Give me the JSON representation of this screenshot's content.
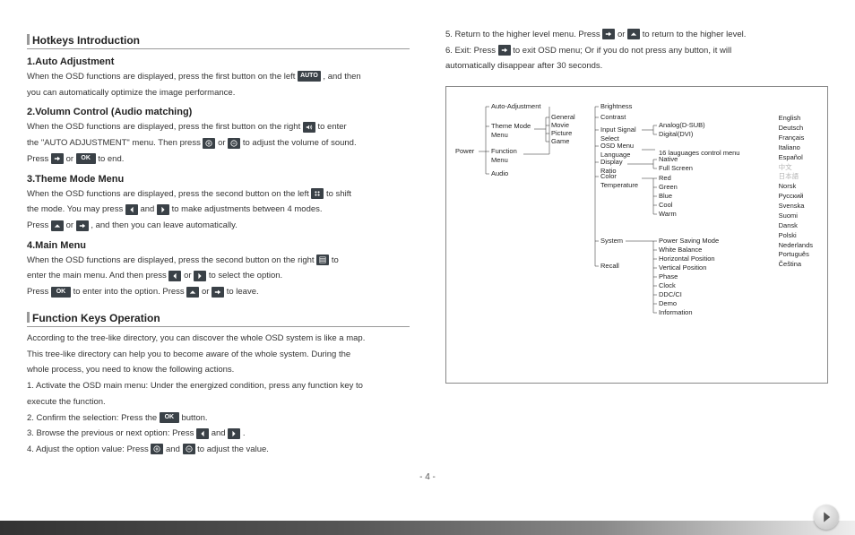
{
  "sections": {
    "hotkeys_title": "Hotkeys Introduction",
    "auto_adj": {
      "title": "1.Auto Adjustment",
      "l1a": "When the OSD functions are displayed, press the first button on the left ",
      "l1b": " , and then",
      "l2": "you can automatically optimize the image performance."
    },
    "volume": {
      "title": "2.Volumn Control (Audio matching)",
      "l1a": "When the OSD functions are displayed, press the first button on the right ",
      "l1b": " to enter",
      "l2a": "the \"AUTO ADJUSTMENT\" menu. Then press ",
      "l2b": " or ",
      "l2c": " to adjust the volume of sound.",
      "l3a": "Press ",
      "l3b": " or ",
      "l3c": " to end."
    },
    "theme": {
      "title": "3.Theme Mode Menu",
      "l1a": "When the OSD functions are displayed, press the second button on the left ",
      "l1b": " to shift",
      "l2a": "the mode. You may press ",
      "l2b": " and ",
      "l2c": " to make adjustments between 4 modes.",
      "l3a": "Press ",
      "l3b": " or ",
      "l3c": " , and then you can leave automatically."
    },
    "main": {
      "title": "4.Main Menu",
      "l1a": "When the OSD functions are displayed, press the second button on the right ",
      "l1b": " to",
      "l2a": "enter the main menu. And then press ",
      "l2b": " or ",
      "l2c": " to select the option.",
      "l3a": "Press ",
      "l3b": " to enter into the option. Press ",
      "l3c": " or ",
      "l3d": " to leave."
    },
    "fkeys_title": "Function Keys Operation",
    "fkeys": {
      "p1": "According to the tree-like directory, you can discover the whole OSD system is like a map.",
      "p2": "This tree-like directory can help you to become aware of the whole system. During the",
      "p3": "whole process, you need to know the following actions.",
      "p4": "1. Activate the OSD main menu: Under the energized condition, press any function key to",
      "p4b": "execute the function.",
      "p5a": "2. Confirm the selection: Press the ",
      "p5b": " button.",
      "p6a": "3. Browse the previous or next option: Press ",
      "p6b": " and ",
      "p6c": " .",
      "p7a": "4. Adjust the option value: Press ",
      "p7b": " and ",
      "p7c": " to adjust the value."
    },
    "right": {
      "p5a": "5. Return to the higher level menu. Press ",
      "p5b": " or ",
      "p5c": " to return to the higher level.",
      "p6a": "6. Exit: Press ",
      "p6b": " to exit OSD menu; Or if you do not press any button, it will",
      "p6c": "automatically disappear after 30 seconds."
    }
  },
  "buttons": {
    "auto": "AUTO",
    "ok": "OK",
    "exit": "EXIT"
  },
  "tree": {
    "power": "Power",
    "auto_adj": "Auto-Adjustment",
    "theme_menu": "Theme Mode\nMenu",
    "function_menu": "Function\nMenu",
    "audio": "Audio",
    "theme_items": [
      "General",
      "Movie",
      "Picture",
      "Game"
    ],
    "fn_items": [
      "Brightness",
      "Contrast",
      "Input Signal\nSelect",
      "OSD Menu\nLanguage",
      "Display\nRatio",
      "Color\nTemperature",
      "System",
      "Recall"
    ],
    "input_items": [
      "Analog(D-SUB)",
      "Digital(DVI)"
    ],
    "osd_note": "16 lauguages control menu",
    "ratio_items": [
      "Native",
      "Full Screen"
    ],
    "color_items": [
      "Red",
      "Green",
      "Blue",
      "Cool",
      "Warm"
    ],
    "system_items": [
      "Power Saving Mode",
      "White Balance",
      "Horizontal Position",
      "Vertical Position",
      "Phase",
      "Clock",
      "DDC/CI",
      "Demo",
      "Information"
    ],
    "languages": [
      "English",
      "Deutsch",
      "Français",
      "Italiano",
      "Español",
      "中文",
      "日本語",
      "Norsk",
      "Pусский",
      "Svenska",
      "Suomi",
      "Dansk",
      "Polski",
      "Nederlands",
      "Português",
      "Čeština"
    ]
  },
  "page_number": "- 4 -"
}
